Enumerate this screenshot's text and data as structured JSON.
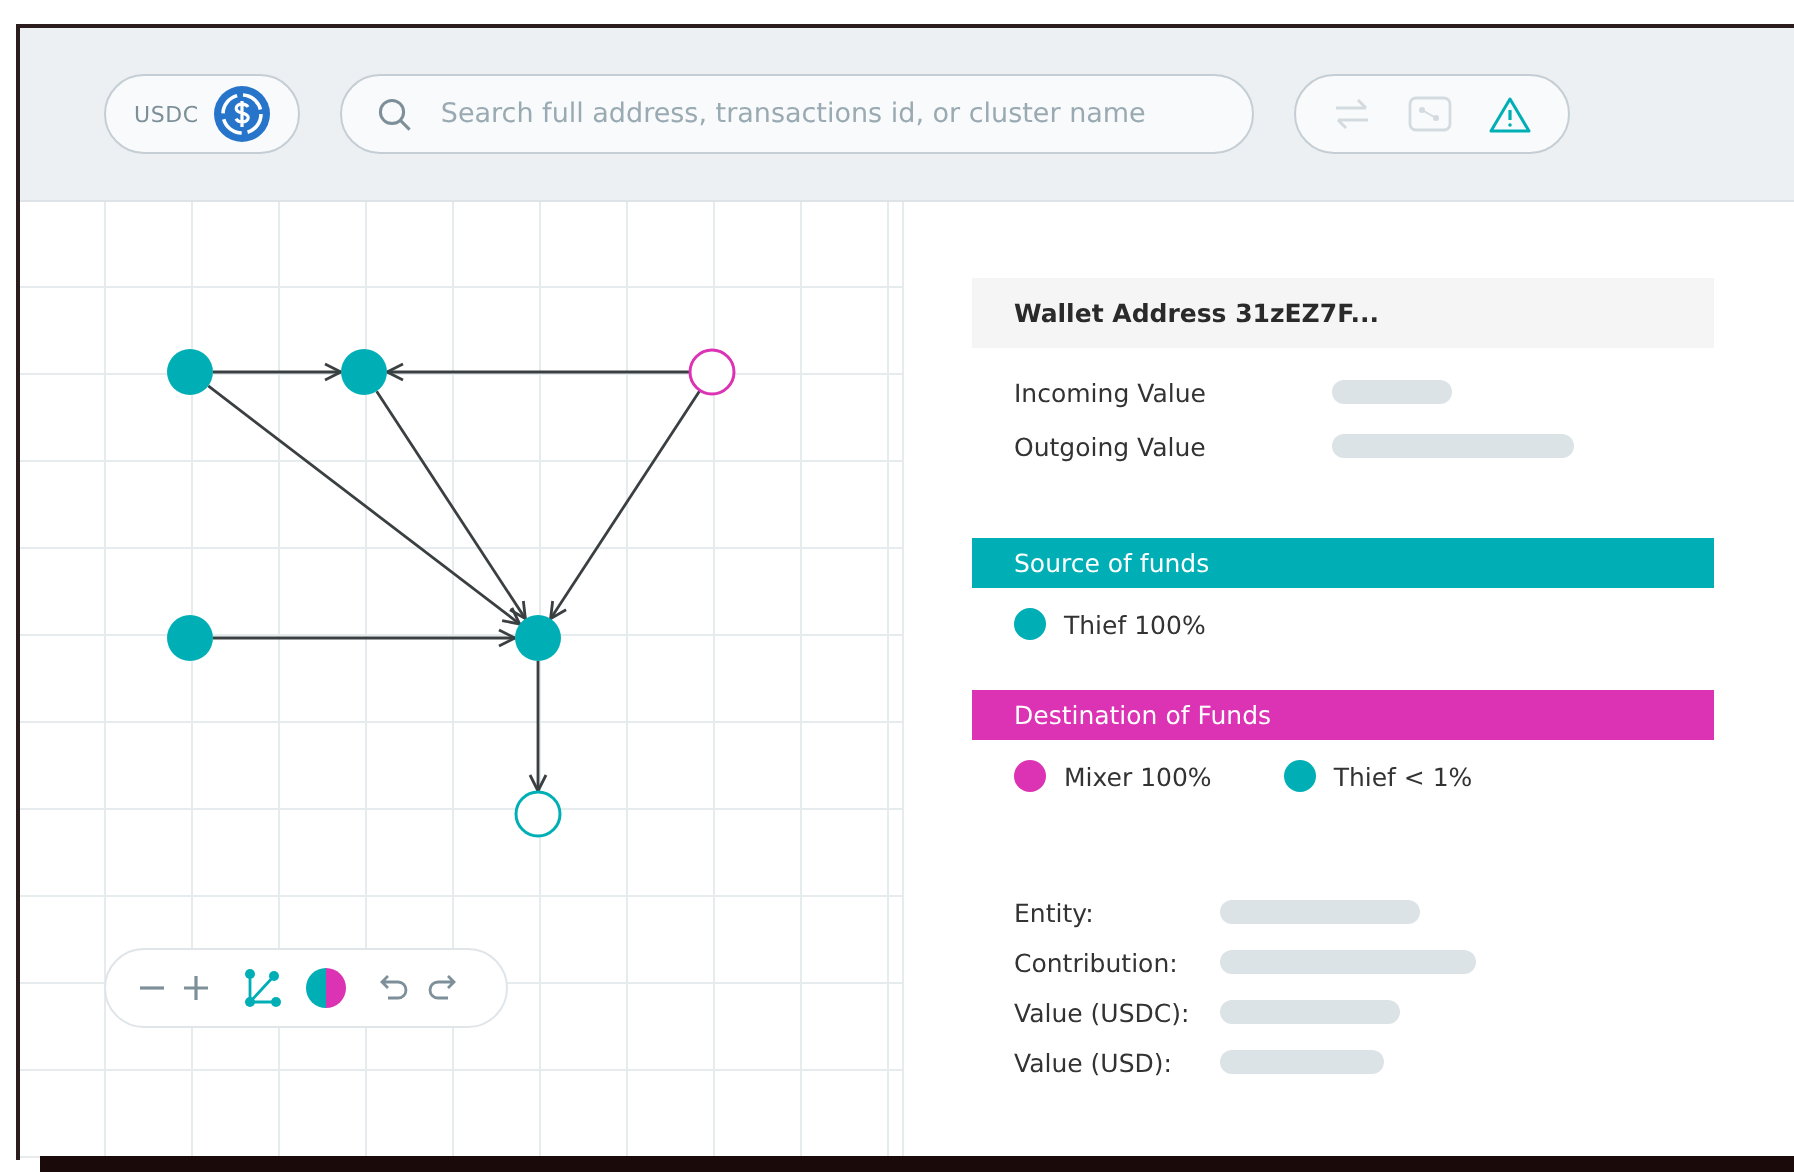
{
  "currency": {
    "label": "USDC"
  },
  "search": {
    "placeholder": "Search full address, transactions id, or cluster name"
  },
  "wallet": {
    "title": "Wallet Address 31zEZ7F...",
    "rows": [
      {
        "label": "Incoming Value"
      },
      {
        "label": "Outgoing Value"
      }
    ]
  },
  "sections": [
    {
      "title": "Source of funds",
      "color": "#00afb5",
      "legend": [
        {
          "label": "Thief 100%",
          "color": "#00afb5"
        }
      ]
    },
    {
      "title": "Destination of Funds",
      "color": "#dc33b5",
      "legend": [
        {
          "label": "Mixer 100%",
          "color": "#dc33b5"
        },
        {
          "label": "Thief < 1%",
          "color": "#00afb5"
        }
      ]
    }
  ],
  "details": [
    {
      "label": "Entity:"
    },
    {
      "label": "Contribution:"
    },
    {
      "label": "Value (USDC):"
    },
    {
      "label": "Value (USD):"
    }
  ]
}
